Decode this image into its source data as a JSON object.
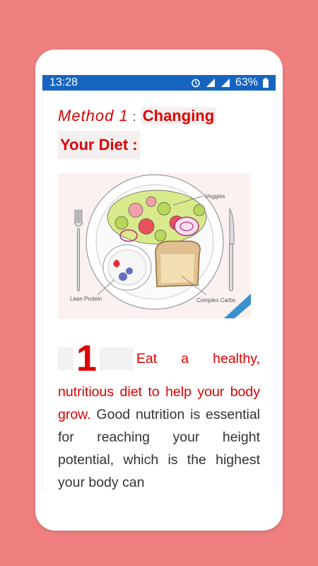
{
  "statusbar": {
    "time": "13:28",
    "battery": "63%",
    "icons": [
      "alarm-icon",
      "signal-icon",
      "signal-icon",
      "battery-icon"
    ]
  },
  "heading": {
    "method": "Method 1",
    "colon": ":",
    "part1": "Changing",
    "part2": "Your Diet :"
  },
  "illustration": {
    "labels": {
      "veggies": "Veggies",
      "protein": "Lean Protein",
      "carbs": "Complex Carbs"
    }
  },
  "step": {
    "number": "1",
    "red_line1": [
      "Eat",
      "a",
      "healthy,"
    ],
    "red_rest": "nutritious diet to help your body grow.",
    "body": " Good nutrition is essential for reaching your height potential, which is the highest your body can"
  },
  "colors": {
    "background": "#f08080",
    "accent": "#e00000",
    "statusbar": "#1565c0"
  }
}
